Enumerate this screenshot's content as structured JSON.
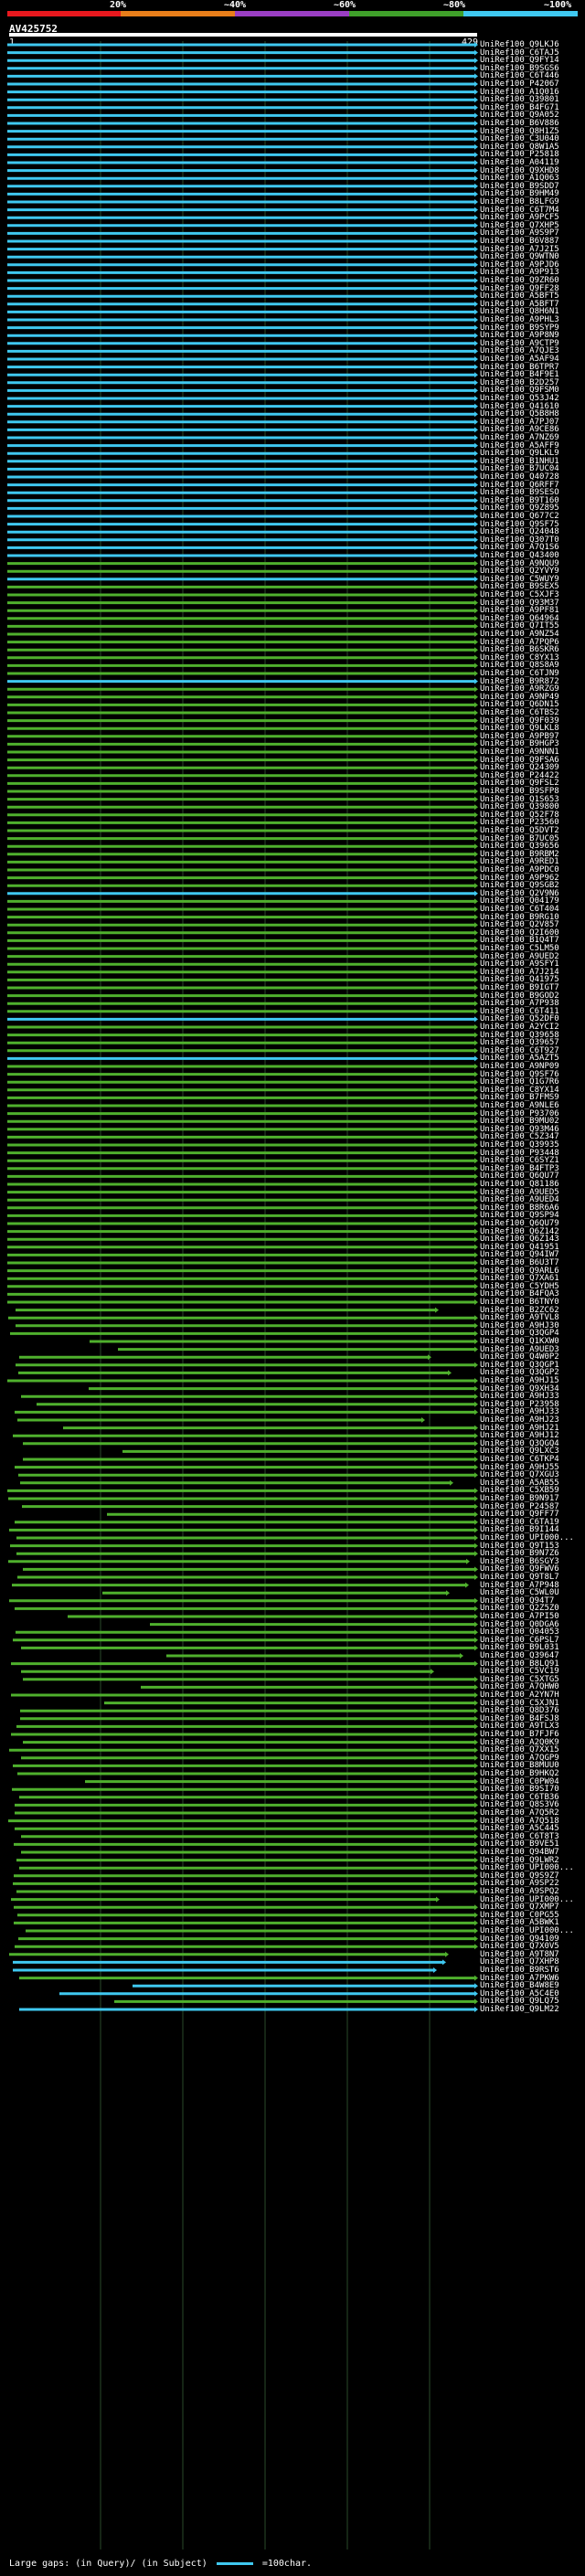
{
  "scale": {
    "labels": [
      "20%",
      "~40%",
      "~60%",
      "~80%",
      "~100%"
    ],
    "colors": [
      "#e8181e",
      "#e87e1a",
      "#9a3ec3",
      "#3fa02a",
      "#3fc8f0"
    ]
  },
  "query": {
    "id": "AV425752",
    "start": "1",
    "end": "429"
  },
  "colors": {
    "blue": "#3fc8f0",
    "green": "#4fb02d",
    "gap": "#ffffff"
  },
  "hits": [
    "UniRef100_Q9LKJ6",
    "UniRef100_C6TAJ5",
    "UniRef100_Q9FY14",
    "UniRef100_B9SGS6",
    "UniRef100_C6T446",
    "UniRef100_P42067",
    "UniRef100_A1Q016",
    "UniRef100_Q39801",
    "UniRef100_B4FG71",
    "UniRef100_Q9A052",
    "UniRef100_B6V886",
    "UniRef100_Q8H1Z5",
    "UniRef100_C3U040",
    "UniRef100_Q8W1A5",
    "UniRef100_P25818",
    "UniRef100_A04119",
    "UniRef100_Q9XHD8",
    "UniRef100_A1Q063",
    "UniRef100_B9SDD7",
    "UniRef100_B9HM49",
    "UniRef100_B8LFG9",
    "UniRef100_C6T7M4",
    "UniRef100_A9PCF5",
    "UniRef100_Q7XHP5",
    "UniRef100_A9S9P7",
    "UniRef100_B6V887",
    "UniRef100_A7J2I5",
    "UniRef100_Q9WTN0",
    "UniRef100_A9PJD6",
    "UniRef100_A9P913",
    "UniRef100_Q9ZR60",
    "UniRef100_Q9FF28",
    "UniRef100_A5BFT5",
    "UniRef100_A5BFT7",
    "UniRef100_Q8H6N1",
    "UniRef100_A9PHL3",
    "UniRef100_B9SYP9",
    "UniRef100_A9P8N9",
    "UniRef100_A9CTP9",
    "UniRef100_A7QJE3",
    "UniRef100_A5AF94",
    "UniRef100_B6TPR7",
    "UniRef100_B4F9E1",
    "UniRef100_B2D257",
    "UniRef100_Q9FSM0",
    "UniRef100_Q53J42",
    "UniRef100_Q41610",
    "UniRef100_Q5B8H8",
    "UniRef100_A7PJ07",
    "UniRef100_A9CE86",
    "UniRef100_A7NZ69",
    "UniRef100_A5AFF9",
    "UniRef100_Q9LKL9",
    "UniRef100_B1NHU1",
    "UniRef100_B7UC04",
    "UniRef100_Q40728",
    "UniRef100_Q6RFF7",
    "UniRef100_B9SESO",
    "UniRef100_B9T160",
    "UniRef100_Q9Z895",
    "UniRef100_Q677C2",
    "UniRef100_Q9SF75",
    "UniRef100_Q24048",
    "UniRef100_Q307T0",
    "UniRef100_A7Q1S6",
    "UniRef100_Q43400",
    "UniRef100_A9NQU9",
    "UniRef100_Q2YVY9",
    "UniRef100_C5WUY9",
    "UniRef100_B9SEX5",
    "UniRef100_C5XJF3",
    "UniRef100_Q93M37",
    "UniRef100_A9PF81",
    "UniRef100_Q64964",
    "UniRef100_Q7IT55",
    "UniRef100_A9NZ54",
    "UniRef100_A7PQP6",
    "UniRef100_B6SKR6",
    "UniRef100_C8YX13",
    "UniRef100_Q8S8A9",
    "UniRef100_C6TJN9",
    "UniRef100_B9R872",
    "UniRef100_A9RZG9",
    "UniRef100_A9NP49",
    "UniRef100_Q6DN15",
    "UniRef100_C6TBS2",
    "UniRef100_Q9F039",
    "UniRef100_Q9LKL8",
    "UniRef100_A9PB97",
    "UniRef100_B9HGP3",
    "UniRef100_A9NNN1",
    "UniRef100_Q9FSA6",
    "UniRef100_Q24309",
    "UniRef100_P24422",
    "UniRef100_Q9FSL2",
    "UniRef100_B9SFP8",
    "UniRef100_Q1S653",
    "UniRef100_Q39800",
    "UniRef100_Q52F78",
    "UniRef100_P23560",
    "UniRef100_Q5DVT2",
    "UniRef100_B7UC05",
    "UniRef100_Q39656",
    "UniRef100_B9RBM2",
    "UniRef100_A9RED1",
    "UniRef100_A9PDC0",
    "UniRef100_A9P962",
    "UniRef100_Q9SGB2",
    "UniRef100_Q2V9N6",
    "UniRef100_Q04179",
    "UniRef100_C6T404",
    "UniRef100_B9RG10",
    "UniRef100_Q2V857",
    "UniRef100_Q2I600",
    "UniRef100_B1Q4T7",
    "UniRef100_C5LM50",
    "UniRef100_A9UED2",
    "UniRef100_A9SFY1",
    "UniRef100_A7J214",
    "UniRef100_Q41975",
    "UniRef100_B9IGT7",
    "UniRef100_B9GOD2",
    "UniRef100_A7P938",
    "UniRef100_C6T411",
    "UniRef100_Q52DF0",
    "UniRef100_A2YCI2",
    "UniRef100_Q39658",
    "UniRef100_Q39657",
    "UniRef100_C6T927",
    "UniRef100_A5AZT5",
    "UniRef100_A9NP09",
    "UniRef100_Q9SF76",
    "UniRef100_Q1G7R6",
    "UniRef100_C8YX14",
    "UniRef100_B7FMS9",
    "UniRef100_A9NLE6",
    "UniRef100_P93706",
    "UniRef100_B9MU02",
    "UniRef100_Q93M46",
    "UniRef100_C5Z347",
    "UniRef100_Q39935",
    "UniRef100_P93448",
    "UniRef100_C6SYZ1",
    "UniRef100_B4FTP3",
    "UniRef100_Q6QU77",
    "UniRef100_Q81186",
    "UniRef100_A9UED5",
    "UniRef100_A9UED4",
    "UniRef100_B8R6A6",
    "UniRef100_Q9SP94",
    "UniRef100_Q6QU79",
    "UniRef100_Q6Z142",
    "UniRef100_Q6Z143",
    "UniRef100_Q41951",
    "UniRef100_Q94IW7",
    "UniRef100_B6U3T7",
    "UniRef100_Q9ARL6",
    "UniRef100_Q7XA61",
    "UniRef100_C5YDH5",
    "UniRef100_B4FQA3",
    "UniRef100_B6TNY0",
    "UniRef100_B2ZC62",
    "UniRef100_A9TVL8",
    "UniRef100_A9HJ30",
    "UniRef100_Q3QGP4",
    "UniRef100_Q1KXW0",
    "UniRef100_A9UED3",
    "UniRef100_Q4W0P2",
    "UniRef100_Q3QGP1",
    "UniRef100_Q3QGP2",
    "UniRef100_A9HJ15",
    "UniRef100_Q9XH34",
    "UniRef100_A9HJ33",
    "UniRef100_P23958",
    "UniRef100_A9HJ33",
    "UniRef100_A9HJ23",
    "UniRef100_A9HJ21",
    "UniRef100_A9HJ12",
    "UniRef100_Q3QGQ4",
    "UniRef100_Q9LXC3",
    "UniRef100_C6TKP4",
    "UniRef100_A9HJ55",
    "UniRef100_Q7XGU3",
    "UniRef100_A5AB55",
    "UniRef100_C5XB59",
    "UniRef100_B9N917",
    "UniRef100_P24587",
    "UniRef100_Q9FF77",
    "UniRef100_C6TA19",
    "UniRef100_B9I144",
    "UniRef100_UPI000...",
    "UniRef100_Q9T153",
    "UniRef100_B9N7Z6",
    "UniRef100_B6SGY3",
    "UniRef100_Q9FWV6",
    "UniRef100_Q9T8L7",
    "UniRef100_A7P948",
    "UniRef100_C5WL0U",
    "UniRef100_Q94T7",
    "UniRef100_Q2Z5Z0",
    "UniRef100_A7PI50",
    "UniRef100_Q0DGA6",
    "UniRef100_Q04053",
    "UniRef100_C6PSL7",
    "UniRef100_B9L031",
    "UniRef100_Q39647",
    "UniRef100_B8LQ91",
    "UniRef100_C5VC19",
    "UniRef100_C5XTG5",
    "UniRef100_A7QHW0",
    "UniRef100_A2YN7H",
    "UniRef100_C5XJN1",
    "UniRef100_Q8D376",
    "UniRef100_B4FSJ8",
    "UniRef100_A9TLX3",
    "UniRef100_B7FJF6",
    "UniRef100_A2Q0K9",
    "UniRef100_Q7XX15",
    "UniRef100_A7QGP9",
    "UniRef100_B8MUU0",
    "UniRef100_B9HKQ2",
    "UniRef100_C0PW04",
    "UniRef100_B9SI70",
    "UniRef100_C6TB36",
    "UniRef100_Q8S3V6",
    "UniRef100_A7Q5R2",
    "UniRef100_A7Q518",
    "UniRef100_A5C445",
    "UniRef100_C6T8T3",
    "UniRef100_B9VE51",
    "UniRef100_Q94BW7",
    "UniRef100_Q9LWR2",
    "UniRef100_UPI000...",
    "UniRef100_Q9S9Z7",
    "UniRef100_A9SP22",
    "UniRef100_A9SPQ2",
    "UniRef100_UPI000...",
    "UniRef100_Q7XMP7",
    "UniRef100_C0PG55",
    "UniRef100_A5BWK1",
    "UniRef100_UPI000...",
    "UniRef100_Q94109",
    "UniRef100_Q7X0V5",
    "UniRef100_A9T8N7",
    "UniRef100_Q7XHP8",
    "UniRef100_B9RST6",
    "UniRef100_A7PKW6",
    "UniRef100_B4W8E9",
    "UniRef100_A5C4E0",
    "UniRef100_Q9LQ75",
    "UniRef100_Q9LM22"
  ],
  "footer": {
    "gaps_label": "Large gaps:",
    "query_label": "(in Query)/",
    "subject_label": "(in Subject)",
    "scale_label": "=100char."
  }
}
